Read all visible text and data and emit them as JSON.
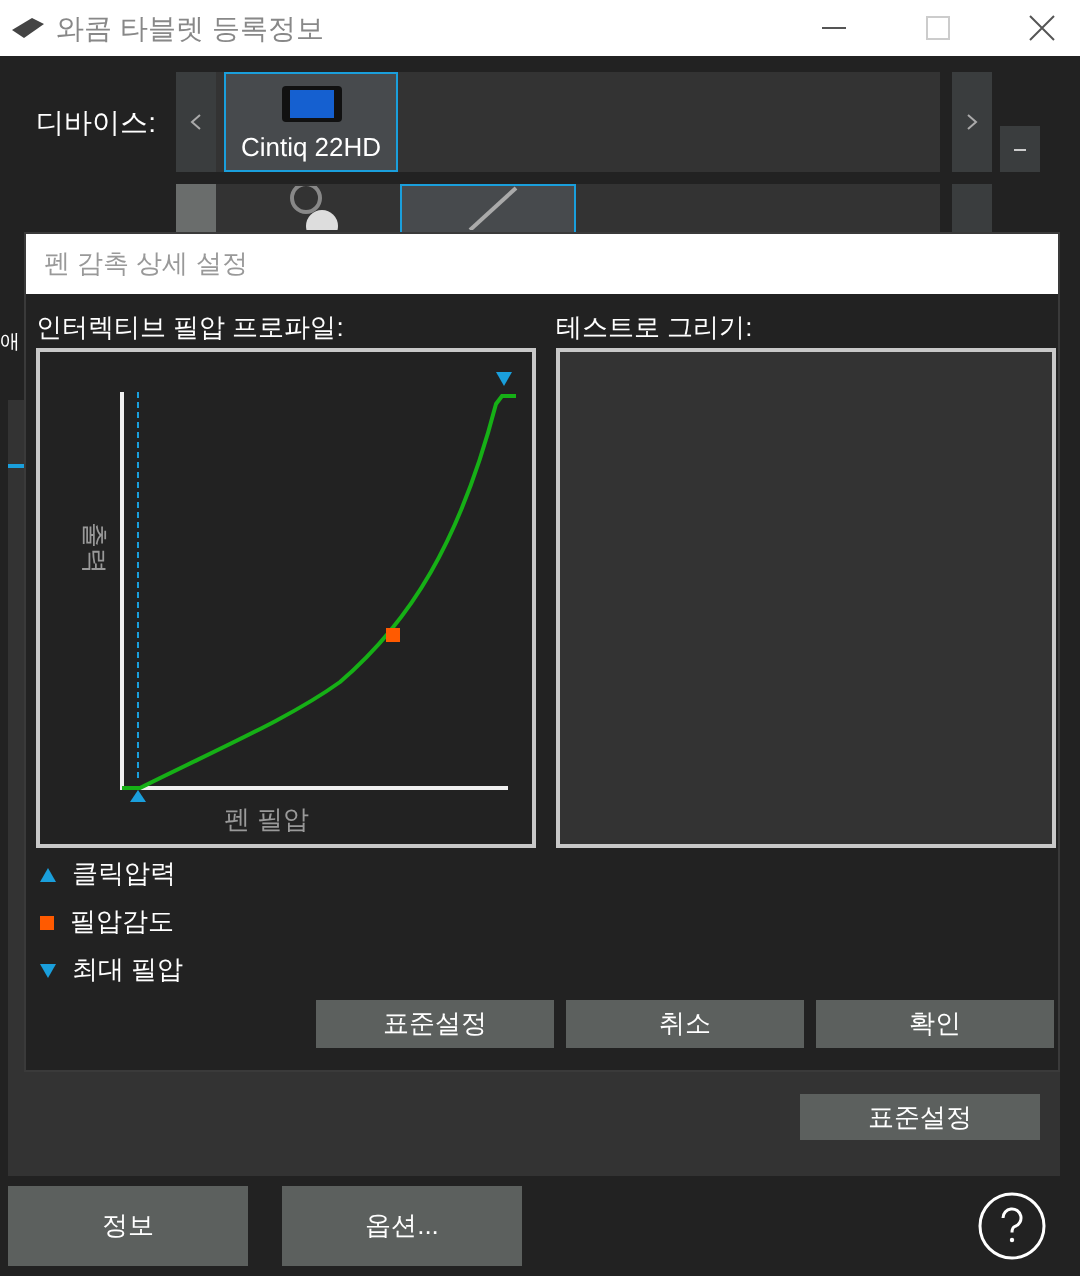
{
  "window": {
    "title": "와콤 타블렛 등록정보"
  },
  "devices": {
    "label": "디바이스:",
    "items": [
      {
        "label": "Cintiq 22HD",
        "selected": true
      }
    ]
  },
  "input_devices": {
    "items": [
      {
        "kind": "wheel",
        "selected": false
      },
      {
        "kind": "pen",
        "selected": true
      }
    ]
  },
  "side_tab": {
    "label": "애"
  },
  "dialog": {
    "title": "펜 감촉 상세 설정",
    "profile_label": "인터렉티브 필압 프로파일:",
    "test_label": "테스트로 그리기:",
    "y_axis": "출력",
    "x_axis": "펜 필압",
    "legend": [
      {
        "kind": "click",
        "label": "클릭압력"
      },
      {
        "kind": "sensitivity",
        "label": "필압감도"
      },
      {
        "kind": "max",
        "label": "최대 필압"
      }
    ],
    "buttons": [
      "표준설정",
      "취소",
      "확인"
    ]
  },
  "reset_button": "표준설정",
  "footer_buttons": [
    "정보",
    "옵션..."
  ]
}
